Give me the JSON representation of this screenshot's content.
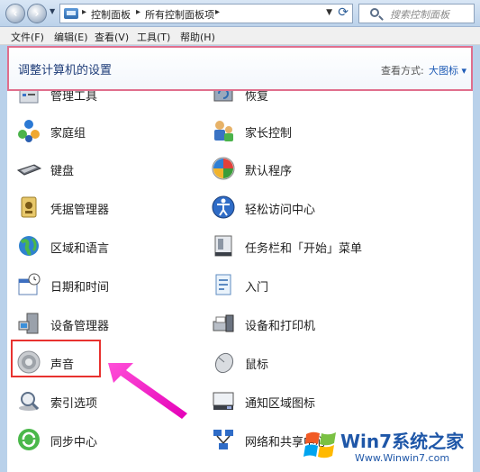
{
  "address_bar": {
    "breadcrumbs": [
      "控制面板",
      "所有控制面板项"
    ],
    "search_placeholder": "搜索控制面板"
  },
  "menu": {
    "items": [
      "文件(F)",
      "编辑(E)",
      "查看(V)",
      "工具(T)",
      "帮助(H)"
    ]
  },
  "header": {
    "title": "调整计算机的设置",
    "view_label": "查看方式:",
    "view_value": "大图标 ▾"
  },
  "items": {
    "left": [
      {
        "label": "管理工具",
        "icon": "admin-tools-icon"
      },
      {
        "label": "家庭组",
        "icon": "homegroup-icon"
      },
      {
        "label": "键盘",
        "icon": "keyboard-icon"
      },
      {
        "label": "凭据管理器",
        "icon": "credential-manager-icon"
      },
      {
        "label": "区域和语言",
        "icon": "region-language-icon"
      },
      {
        "label": "日期和时间",
        "icon": "date-time-icon"
      },
      {
        "label": "设备管理器",
        "icon": "device-manager-icon"
      },
      {
        "label": "声音",
        "icon": "sound-icon"
      },
      {
        "label": "索引选项",
        "icon": "indexing-options-icon"
      },
      {
        "label": "同步中心",
        "icon": "sync-center-icon"
      }
    ],
    "right": [
      {
        "label": "恢复",
        "icon": "recovery-icon"
      },
      {
        "label": "家长控制",
        "icon": "parental-controls-icon"
      },
      {
        "label": "默认程序",
        "icon": "default-programs-icon"
      },
      {
        "label": "轻松访问中心",
        "icon": "ease-of-access-icon"
      },
      {
        "label": "任务栏和「开始」菜单",
        "icon": "taskbar-start-menu-icon"
      },
      {
        "label": "入门",
        "icon": "getting-started-icon"
      },
      {
        "label": "设备和打印机",
        "icon": "devices-printers-icon"
      },
      {
        "label": "鼠标",
        "icon": "mouse-icon"
      },
      {
        "label": "通知区域图标",
        "icon": "notification-area-icon"
      },
      {
        "label": "网络和共享中心",
        "icon": "network-sharing-icon"
      }
    ]
  },
  "watermark": {
    "title": "Win7系统之家",
    "url": "Www.Winwin7.com"
  }
}
